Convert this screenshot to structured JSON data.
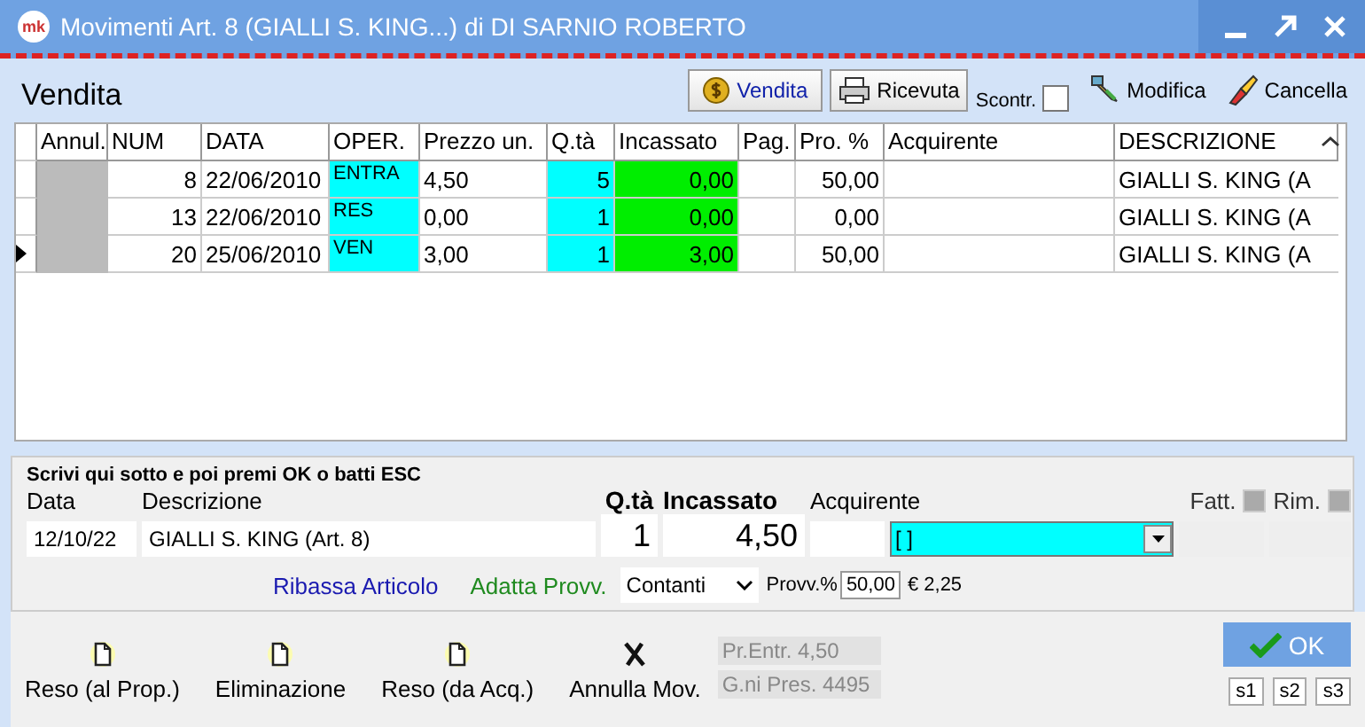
{
  "window": {
    "logo_text": "mk",
    "title": "Movimenti Art. 8 (GIALLI S. KING...) di DI SARNIO ROBERTO"
  },
  "header": {
    "title": "Vendita",
    "buttons": [
      {
        "label": "Vendita",
        "kind": "coin"
      },
      {
        "label": "Ricevuta",
        "kind": "printer"
      }
    ],
    "scontr": {
      "label": "Scontr.",
      "checked": false
    },
    "links": [
      {
        "label": "Modifica",
        "kind": "edit"
      },
      {
        "label": "Cancella",
        "kind": "erase"
      }
    ]
  },
  "table": {
    "columns": [
      "Annul.",
      "NUM",
      "DATA",
      "OPER.",
      "Prezzo un.",
      "Q.tà",
      "Incassato",
      "Pag.",
      "Pro. %",
      "Acquirente",
      "DESCRIZIONE"
    ],
    "rows": [
      {
        "selected": false,
        "cells": [
          "",
          "8",
          "22/06/2010",
          "ENTRA",
          "4,50",
          "5",
          "0,00",
          "",
          "50,00",
          "",
          "GIALLI S. KING (A"
        ]
      },
      {
        "selected": false,
        "cells": [
          "",
          "13",
          "22/06/2010",
          "RES",
          "0,00",
          "1",
          "0,00",
          "",
          "0,00",
          "",
          "GIALLI S. KING (A"
        ]
      },
      {
        "selected": true,
        "cells": [
          "",
          "20",
          "25/06/2010",
          "VEN",
          "3,00",
          "1",
          "3,00",
          "",
          "50,00",
          "",
          "GIALLI S. KING (A"
        ]
      }
    ]
  },
  "form": {
    "instruction": "Scrivi qui sotto e poi premi OK o batti ESC",
    "date_label": "Data",
    "date": "12/10/22",
    "description_label": "Descrizione",
    "description": "GIALLI S. KING (Art. 8)",
    "qty_label": "Q.tà",
    "qty": "1",
    "incassato_label": "Incassato",
    "incassato": "4,50",
    "buyer_label": "Acquirente",
    "buyer_combo": "[ ]",
    "fatt": {
      "label": "Fatt.",
      "checked": false
    },
    "rim": {
      "label": "Rim.",
      "checked": false
    },
    "ribassa_link": "Ribassa Articolo",
    "adatta_link": "Adatta Provv.",
    "payment": "Contanti",
    "provv_label": "Provv.%",
    "provv": "50,00",
    "provv_amount": "€ 2,25"
  },
  "actions": [
    {
      "label": "Reso (al Prop.)",
      "kind": "doc"
    },
    {
      "label": "Eliminazione",
      "kind": "doc"
    },
    {
      "label": "Reso (da Acq.)",
      "kind": "doc"
    },
    {
      "label": "Annulla Mov.",
      "kind": "x"
    }
  ],
  "info": [
    "Pr.Entr. 4,50",
    "G.ni Pres. 4495"
  ],
  "ok_button": "OK",
  "shortcuts": [
    "s1",
    "s2",
    "s3"
  ]
}
